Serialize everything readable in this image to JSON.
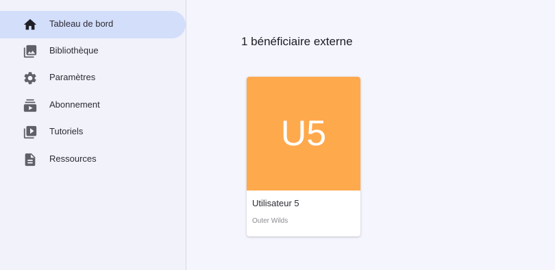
{
  "sidebar": {
    "items": [
      {
        "label": "Tableau de bord",
        "icon": "home-icon",
        "active": true
      },
      {
        "label": "Bibliothèque",
        "icon": "photo-library-icon",
        "active": false
      },
      {
        "label": "Paramètres",
        "icon": "gear-icon",
        "active": false
      },
      {
        "label": "Abonnement",
        "icon": "subscriptions-icon",
        "active": false
      },
      {
        "label": "Tutoriels",
        "icon": "video-library-icon",
        "active": false
      },
      {
        "label": "Ressources",
        "icon": "document-icon",
        "active": false
      }
    ]
  },
  "main": {
    "heading": "1 bénéficiaire externe",
    "cards": [
      {
        "initials": "U5",
        "name": "Utilisateur 5",
        "subtitle": "Outer Wilds",
        "avatar_color": "#ffa94d"
      }
    ]
  },
  "colors": {
    "active_nav_bg": "#d3defb",
    "sidebar_bg": "#f1f2fa",
    "page_bg": "#f5f5fd",
    "icon_color": "#5f6068"
  }
}
